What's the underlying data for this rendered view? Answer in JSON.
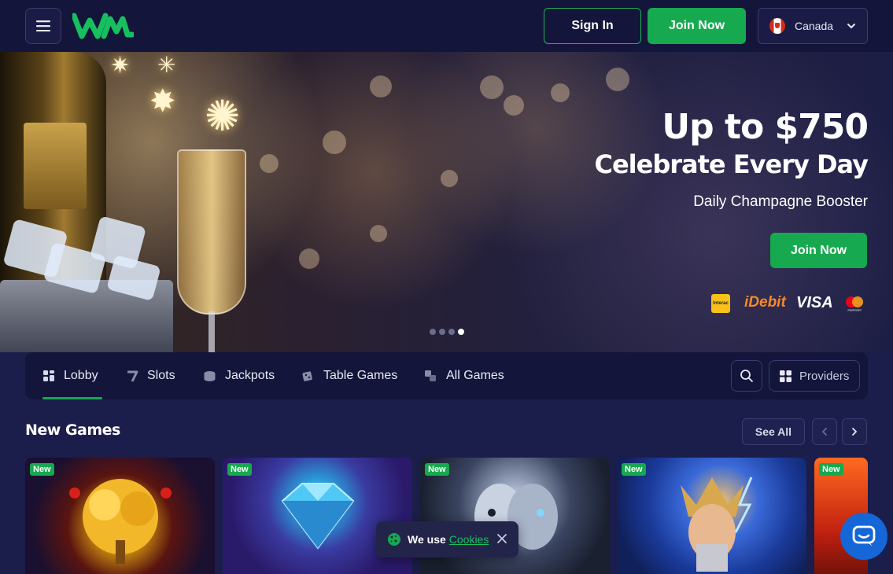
{
  "header": {
    "sign_in_label": "Sign In",
    "join_now_label": "Join Now",
    "country": "Canada"
  },
  "hero": {
    "title_line1": "Up to $750",
    "title_line2": "Celebrate Every Day",
    "subtitle": "Daily Champagne Booster",
    "cta_label": "Join Now",
    "payments": {
      "interac": "Interac",
      "idebit": "iDebit",
      "visa": "VISA",
      "mastercard": "mastercard"
    },
    "slides_count": 4,
    "active_slide": 4
  },
  "nav": {
    "items": [
      {
        "label": "Lobby",
        "icon": "lobby-icon"
      },
      {
        "label": "Slots",
        "icon": "slots-icon"
      },
      {
        "label": "Jackpots",
        "icon": "jackpots-icon"
      },
      {
        "label": "Table Games",
        "icon": "table-games-icon"
      },
      {
        "label": "All Games",
        "icon": "all-games-icon"
      }
    ],
    "active": "Lobby",
    "providers_label": "Providers"
  },
  "new_games": {
    "title": "New Games",
    "see_all_label": "See All",
    "cards": [
      {
        "badge": "New"
      },
      {
        "badge": "New"
      },
      {
        "badge": "New"
      },
      {
        "badge": "New"
      },
      {
        "badge": "New"
      }
    ]
  },
  "cookie": {
    "text": "We use",
    "link": "Cookies"
  },
  "colors": {
    "accent_green": "#17a94f",
    "background": "#1b1d4a",
    "header": "#13153a",
    "chat_blue": "#1566d6"
  }
}
